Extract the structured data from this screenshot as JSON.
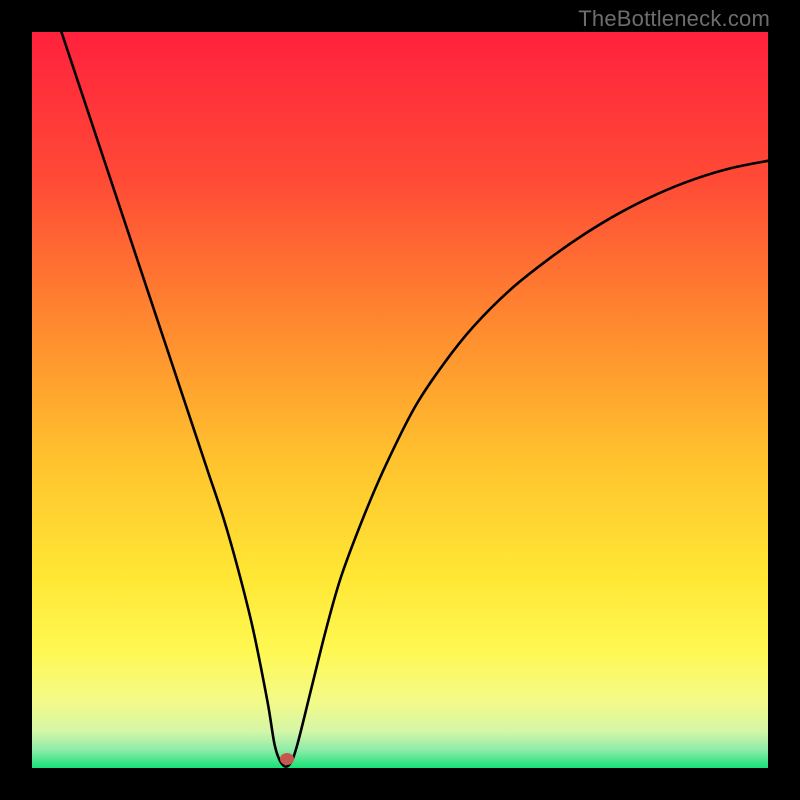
{
  "watermark": "TheBottleneck.com",
  "chart_data": {
    "type": "line",
    "title": "",
    "xlabel": "",
    "ylabel": "",
    "xlim": [
      0,
      100
    ],
    "ylim": [
      0,
      100
    ],
    "grid": false,
    "legend": false,
    "gradient_stops": [
      {
        "pct": 0,
        "color": "#ff213d"
      },
      {
        "pct": 20,
        "color": "#ff4a36"
      },
      {
        "pct": 40,
        "color": "#ff8a2f"
      },
      {
        "pct": 58,
        "color": "#ffc22e"
      },
      {
        "pct": 74,
        "color": "#ffe734"
      },
      {
        "pct": 84,
        "color": "#fff852"
      },
      {
        "pct": 91,
        "color": "#f3fa89"
      },
      {
        "pct": 95,
        "color": "#d4f6a7"
      },
      {
        "pct": 97.5,
        "color": "#8feca9"
      },
      {
        "pct": 100,
        "color": "#17e276"
      }
    ],
    "series": [
      {
        "name": "bottleneck-curve",
        "color": "#000000",
        "x": [
          4,
          6,
          8,
          10,
          12,
          14,
          16,
          18,
          20,
          22,
          24,
          26,
          28,
          30,
          32,
          33,
          34,
          35,
          36,
          38,
          40,
          42,
          45,
          48,
          52,
          56,
          60,
          65,
          70,
          75,
          80,
          85,
          90,
          95,
          100
        ],
        "y": [
          100,
          94,
          88,
          82,
          76,
          70,
          64,
          58,
          52,
          46,
          40,
          34,
          27,
          19,
          9,
          3,
          0.5,
          0.5,
          3,
          11,
          19,
          26,
          34,
          41,
          49,
          55,
          60,
          65,
          69,
          72.5,
          75.5,
          78,
          80,
          81.5,
          82.5
        ]
      }
    ],
    "marker": {
      "x": 34.6,
      "y": 1.2,
      "color": "#c6574e"
    }
  }
}
